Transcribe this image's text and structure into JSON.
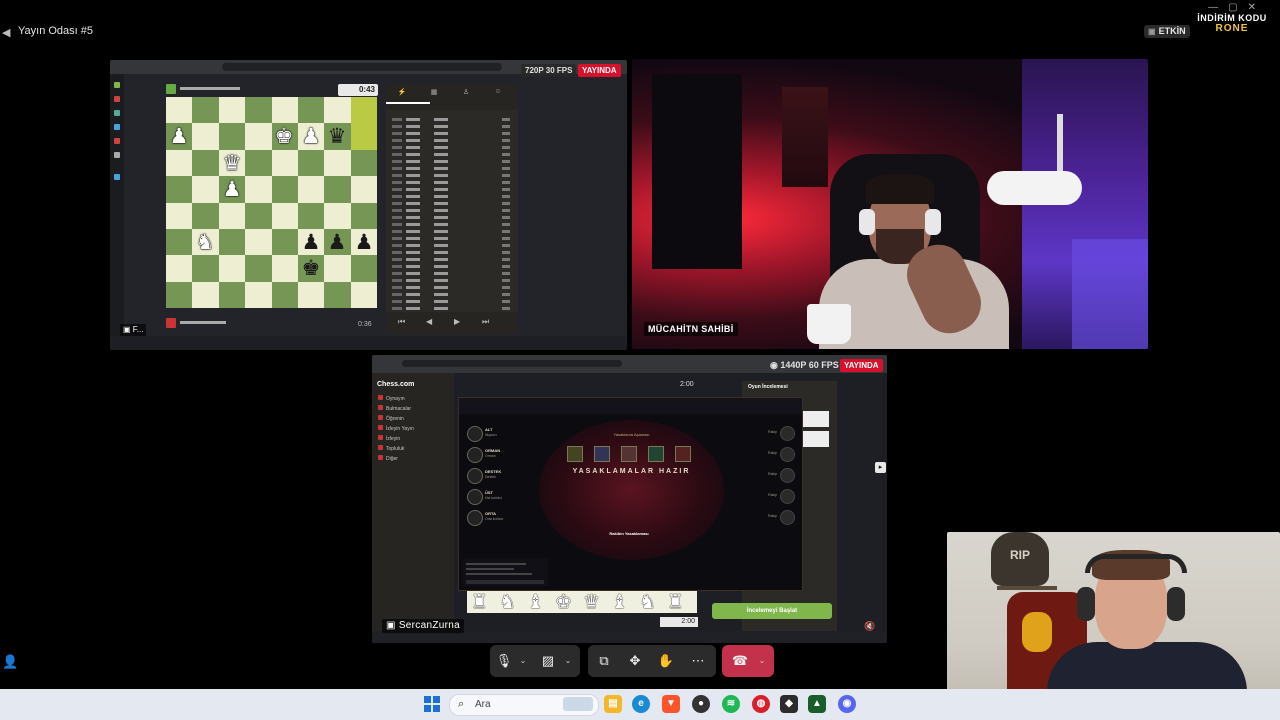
{
  "window": {
    "title": "Yayın Odası #5",
    "status_label": "ETKİN",
    "promo_line1": "İNDİRİM KODU",
    "promo_line2": "RONE"
  },
  "tiles": {
    "chess_share": {
      "fps": "720P 30 FPS",
      "live": "YAYINDA",
      "clock_top": "0:43",
      "clock_bottom": "0:36",
      "presenter": "F..."
    },
    "camera_main": {
      "name": "MÜCAHİTN SAHİBİ"
    },
    "game_share": {
      "fps": "1440P 60 FPS",
      "live": "YAYINDA",
      "presenter": "SercanZurna",
      "timer_top": "2:00",
      "timer_bottom": "2:00",
      "review_title": "Oyun İncelemesi",
      "start_review": "İncelemeyi Başlat",
      "site_logo": "Chess.com",
      "nav": [
        "Oynayın",
        "Bulmacalar",
        "Öğrenin",
        "İzleyin Yayın",
        "İzleyin",
        "Topluluk",
        "Diğer"
      ],
      "lol": {
        "ban_title": "YASAKLAMALAR HAZIR",
        "ban_sub": "Yasaklama Aşaması",
        "ready_text": "Rakibin Yasaklaması",
        "team": [
          {
            "name": "ALT",
            "role": "Nişancı"
          },
          {
            "name": "ORMAN",
            "role": "Orman"
          },
          {
            "name": "DESTEK",
            "role": "Destek"
          },
          {
            "name": "ÜST",
            "role": "Üst koridor"
          },
          {
            "name": "ORTA",
            "role": "Orta koridor"
          }
        ],
        "enemy_label": "Rakip"
      }
    }
  },
  "taskbar": {
    "search_placeholder": "Ara"
  },
  "colors": {
    "live_red": "#d8102b",
    "hangup_red": "#c4314b",
    "chess_light": "#eeeed2",
    "chess_dark": "#769656",
    "promo_gold": "#f3c440",
    "review_green": "#81b64c"
  }
}
